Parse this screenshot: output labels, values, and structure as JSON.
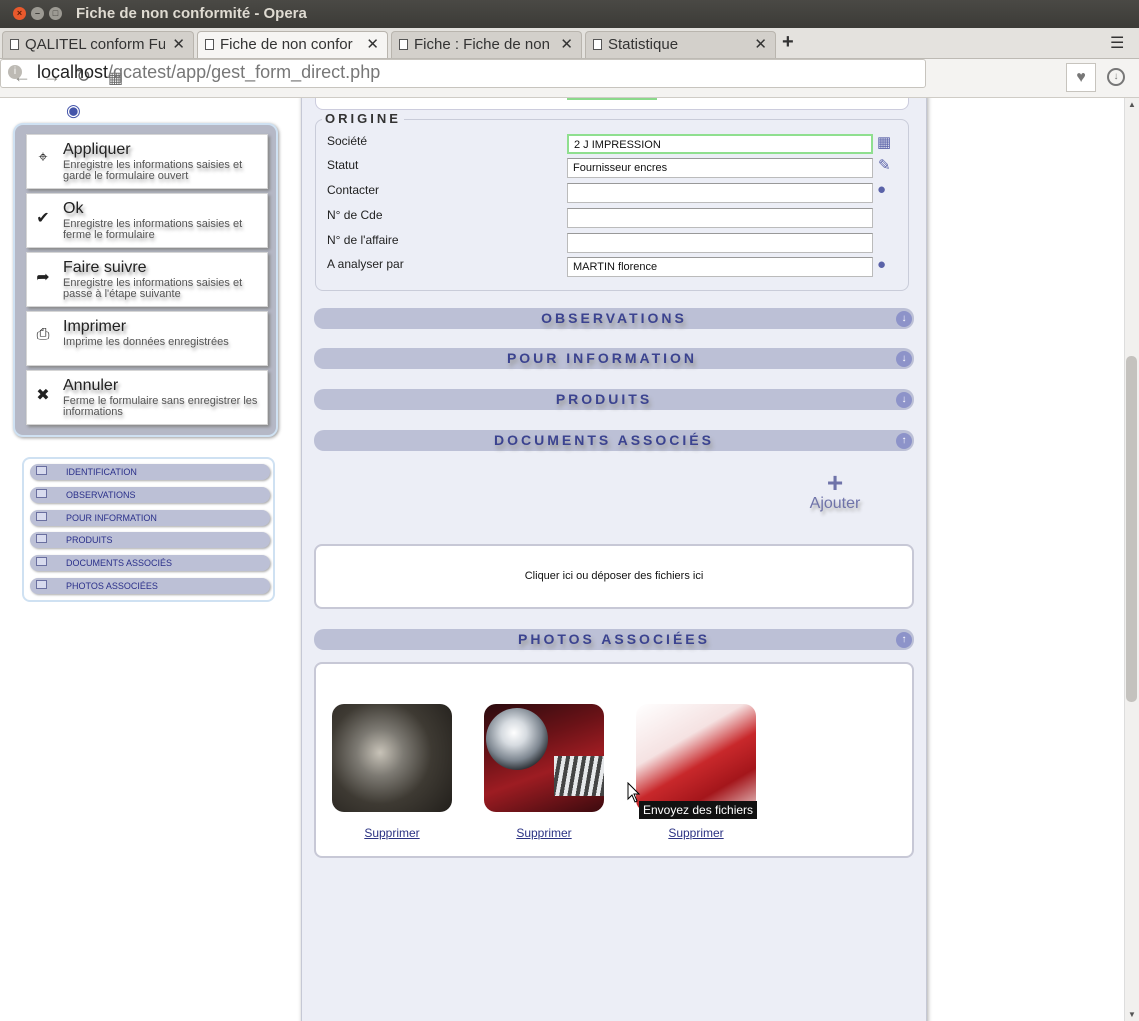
{
  "window": {
    "title": "Fiche de non conformité - Opera"
  },
  "tabs": [
    {
      "label": "QALITEL conform Fu"
    },
    {
      "label": "Fiche de non confor"
    },
    {
      "label": "Fiche : Fiche de non c"
    },
    {
      "label": "Statistique"
    }
  ],
  "address": {
    "host": "localhost",
    "path": "/qcatest/app/gest_form_direct.php"
  },
  "actions": [
    {
      "icon": "pin-icon",
      "title": "Appliquer",
      "desc": "Enregistre les informations saisies et garde le formulaire ouvert"
    },
    {
      "icon": "check-icon",
      "title": "Ok",
      "desc": "Enregistre les informations saisies et ferme le formulaire"
    },
    {
      "icon": "forward-arrow-icon",
      "title": "Faire suivre",
      "desc": "Enregistre les informations saisies et passe à l'étape suivante"
    },
    {
      "icon": "printer-icon",
      "title": "Imprimer",
      "desc": "Imprime les données enregistrées"
    },
    {
      "icon": "close-icon",
      "title": "Annuler",
      "desc": "Ferme le formulaire sans enregistrer les informations"
    }
  ],
  "nav": [
    {
      "label": "IDENTIFICATION"
    },
    {
      "label": "OBSERVATIONS"
    },
    {
      "label": "POUR INFORMATION"
    },
    {
      "label": "PRODUITS"
    },
    {
      "label": "DOCUMENTS ASSOCIÉS"
    },
    {
      "label": "PHOTOS ASSOCIÉES"
    }
  ],
  "origin": {
    "legend": "ORIGINE",
    "fields": [
      {
        "label": "Société",
        "value": "2 J IMPRESSION",
        "icon": "building-icon"
      },
      {
        "label": "Statut",
        "value": "Fournisseur encres",
        "icon": "edit-icon"
      },
      {
        "label": "Contacter",
        "value": "",
        "icon": "person-icon"
      },
      {
        "label": "N° de Cde",
        "value": ""
      },
      {
        "label": "N° de l'affaire",
        "value": ""
      },
      {
        "label": "A analyser par",
        "value": "MARTIN florence",
        "icon": "person-icon"
      }
    ]
  },
  "sections": {
    "observations": "OBSERVATIONS",
    "pour_information": "POUR INFORMATION",
    "produits": "PRODUITS",
    "documents": "DOCUMENTS ASSOCIÉS",
    "photos": "PHOTOS ASSOCIÉES"
  },
  "documents": {
    "add_label": "Ajouter",
    "dropzone": "Cliquer ici ou déposer des fichiers ici"
  },
  "photos": [
    {
      "subject": "engine",
      "delete_label": "Supprimer"
    },
    {
      "subject": "red car headlight",
      "delete_label": "Supprimer"
    },
    {
      "subject": "red capsules",
      "delete_label": "Supprimer"
    }
  ],
  "tooltip": "Envoyez des fichiers"
}
